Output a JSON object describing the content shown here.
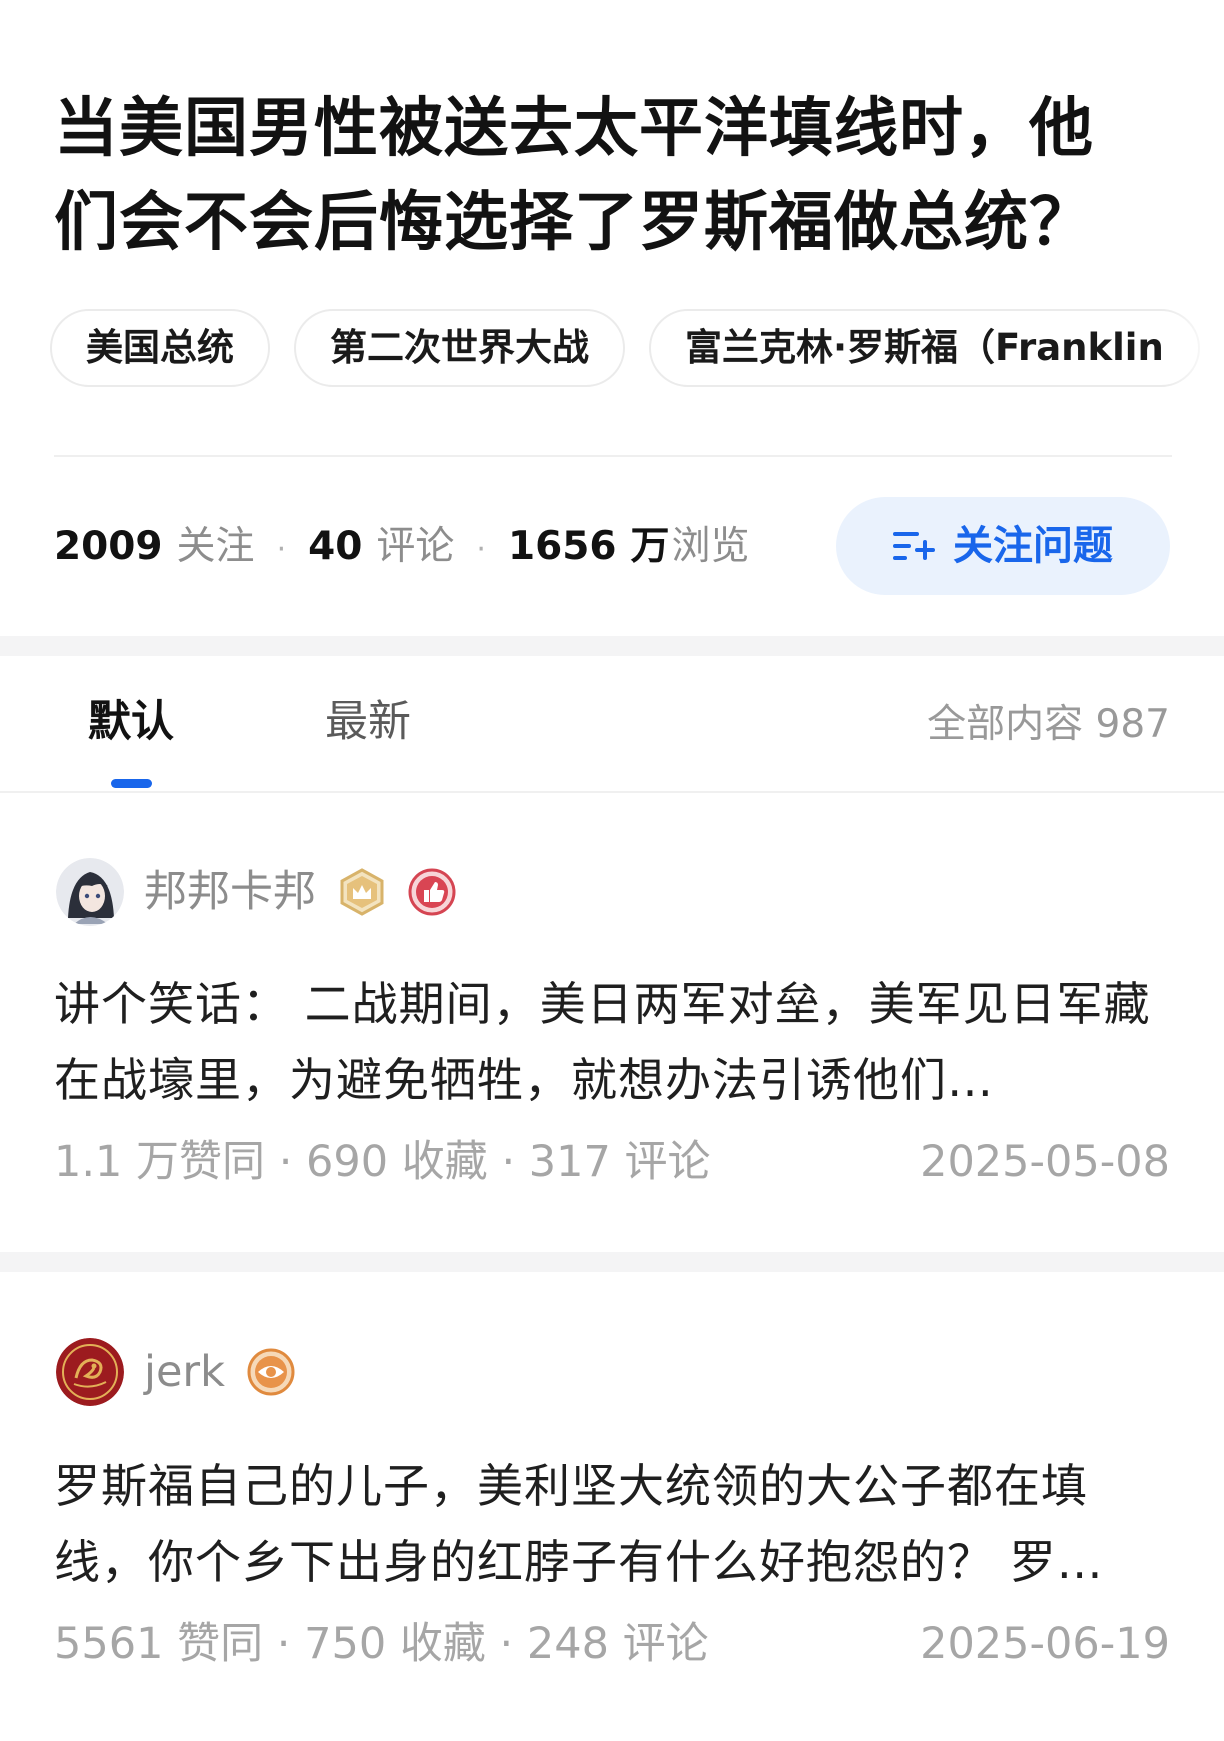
{
  "question": {
    "title": "当美国男性被送去太平洋填线时，他们会不会后悔选择了罗斯福做总统？",
    "topics": [
      "美国总统",
      "第二次世界大战",
      "富兰克林·罗斯福（Franklin"
    ]
  },
  "stats": {
    "followers": "2009",
    "followers_label": "关注",
    "comments": "40",
    "comments_label": "评论",
    "views": "1656",
    "views_unit": "万",
    "views_label": "浏览",
    "separator": "·"
  },
  "follow_button": {
    "label": "关注问题",
    "color": "#1966eb",
    "background": "#eaf2fd"
  },
  "tabs": {
    "default": "默认",
    "latest": "最新",
    "all_content": "全部内容 987",
    "indicator_color": "#1966eb"
  },
  "answers": [
    {
      "author": "邦邦卡邦",
      "badges": [
        "crown-badge-icon",
        "thumbs-up-badge-icon"
      ],
      "excerpt": "讲个笑话： 二战期间，美日两军对垒，美军见日军藏在战壕里，为避免牺牲，就想办法引诱他们…",
      "meta": "1.1 万赞同 · 690 收藏 · 317 评论",
      "date": "2025-05-08"
    },
    {
      "author": "jerk",
      "badges": [
        "eye-badge-icon"
      ],
      "excerpt": "罗斯福自己的儿子，美利坚大统领的大公子都在填线，你个乡下出身的红脖子有什么好抱怨的？ 罗…",
      "meta": "5561 赞同 · 750 收藏 · 248 评论",
      "date": "2025-06-19"
    }
  ]
}
